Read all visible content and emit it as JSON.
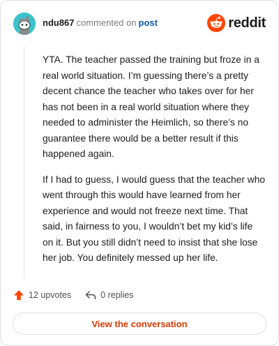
{
  "header": {
    "username": "ndu867",
    "action_text": "commented on",
    "post_link": "post",
    "brand_name": "reddit",
    "avatar_color": "#3cc2c9",
    "brand_color": "#ff4500"
  },
  "comment": {
    "paragraphs": [
      "YTA. The teacher passed the training but froze in a real world situation. I’m guessing there’s a pretty decent chance the teacher who takes over for her has not been in a real world situation where they needed to administer the Heimlich, so there’s no guarantee there would be a better result if this happened again.",
      "If I had to guess, I would guess that the teacher who went through this would have learned from her experience and would not freeze next time. That said, in fairness to you, I wouldn’t bet my kid’s life on it. But you still didn’t need to insist that she lose her job. You definitely messed up her life."
    ]
  },
  "footer": {
    "upvotes": "12 upvotes",
    "replies": "0 replies",
    "upvote_icon": "upvote-arrow-icon",
    "reply_icon": "reply-icon"
  },
  "cta": {
    "label": "View the conversation",
    "color": "#d93a00"
  }
}
